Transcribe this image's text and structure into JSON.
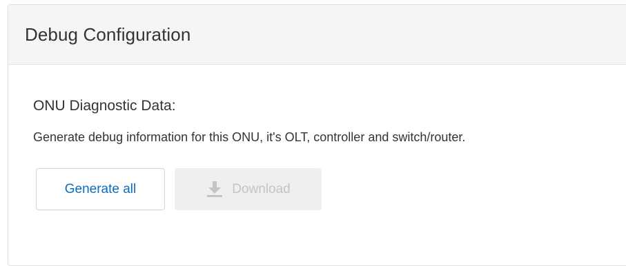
{
  "panel": {
    "title": "Debug Configuration"
  },
  "section": {
    "title": "ONU Diagnostic Data:",
    "description": "Generate debug information for this ONU, it's OLT, controller and switch/router."
  },
  "buttons": {
    "generate_label": "Generate all",
    "download_label": "Download",
    "download_icon": "download-icon",
    "download_disabled": true
  },
  "colors": {
    "link_blue": "#0b6bbf",
    "header_bg": "#f5f5f5",
    "disabled_bg": "#efefef",
    "disabled_text": "#c4c4c4"
  }
}
